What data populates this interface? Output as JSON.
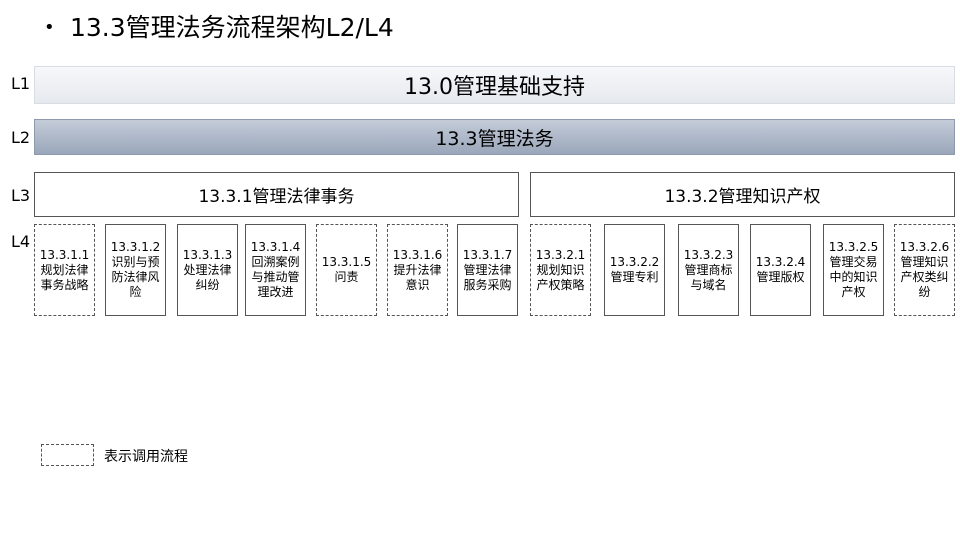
{
  "title": {
    "bullet": "•",
    "text": "13.3管理法务流程架构L2/L4"
  },
  "levels": {
    "l1": "L1",
    "l2": "L2",
    "l3": "L3",
    "l4": "L4"
  },
  "l1": {
    "label": "13.0管理基础支持"
  },
  "l2": {
    "label": "13.3管理法务"
  },
  "l3": [
    {
      "label": "13.3.1管理法律事务"
    },
    {
      "label": "13.3.2管理知识产权"
    }
  ],
  "l4": [
    {
      "label": "13.3.1.1规划法律事务战略",
      "dashed": true
    },
    {
      "label": "13.3.1.2识别与预防法律风险",
      "dashed": false
    },
    {
      "label": "13.3.1.3处理法律纠纷",
      "dashed": false
    },
    {
      "label": "13.3.1.4回溯案例与推动管理改进",
      "dashed": false
    },
    {
      "label": "13.3.1.5问责",
      "dashed": true
    },
    {
      "label": "13.3.1.6提升法律意识",
      "dashed": true
    },
    {
      "label": "13.3.1.7管理法律服务采购",
      "dashed": false
    },
    {
      "label": "13.3.2.1规划知识产权策略",
      "dashed": true
    },
    {
      "label": "13.3.2.2管理专利",
      "dashed": false
    },
    {
      "label": "13.3.2.3管理商标与域名",
      "dashed": false
    },
    {
      "label": "13.3.2.4管理版权",
      "dashed": false
    },
    {
      "label": "13.3.2.5管理交易中的知识产权",
      "dashed": false
    },
    {
      "label": "13.3.2.6管理知识产权类纠纷",
      "dashed": true
    }
  ],
  "legend": {
    "text": "表示调用流程"
  }
}
